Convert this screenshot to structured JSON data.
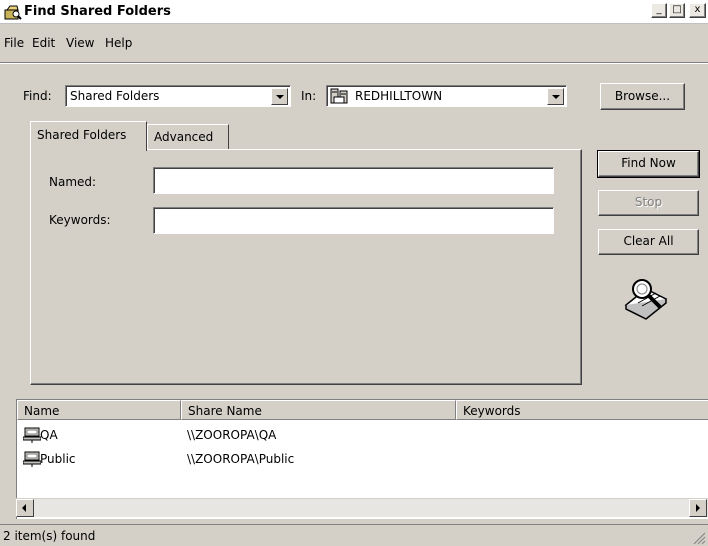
{
  "window": {
    "title": "Find Shared Folders",
    "min_label": "_",
    "max_label": "□",
    "close_label": "x"
  },
  "menu": [
    "File",
    "Edit",
    "View",
    "Help"
  ],
  "find_row": {
    "find_label": "Find:",
    "find_value": "Shared Folders",
    "in_label": "In:",
    "in_value": "REDHILLTOWN",
    "browse_label": "Browse..."
  },
  "tabs": [
    "Shared Folders",
    "Advanced"
  ],
  "form": {
    "named_label": "Named:",
    "named_value": "",
    "keywords_label": "Keywords:",
    "keywords_value": ""
  },
  "buttons": {
    "find_now": "Find Now",
    "stop": "Stop",
    "clear_all": "Clear All"
  },
  "results": {
    "columns": [
      "Name",
      "Share Name",
      "Keywords"
    ],
    "rows": [
      {
        "name": "QA",
        "share": "\\\\ZOOROPA\\QA",
        "keywords": ""
      },
      {
        "name": "Public",
        "share": "\\\\ZOOROPA\\Public",
        "keywords": ""
      }
    ]
  },
  "status": "2 item(s) found",
  "colors": {
    "face": "#d4d0c8",
    "shadow": "#808080",
    "highlight": "#ffffff"
  }
}
